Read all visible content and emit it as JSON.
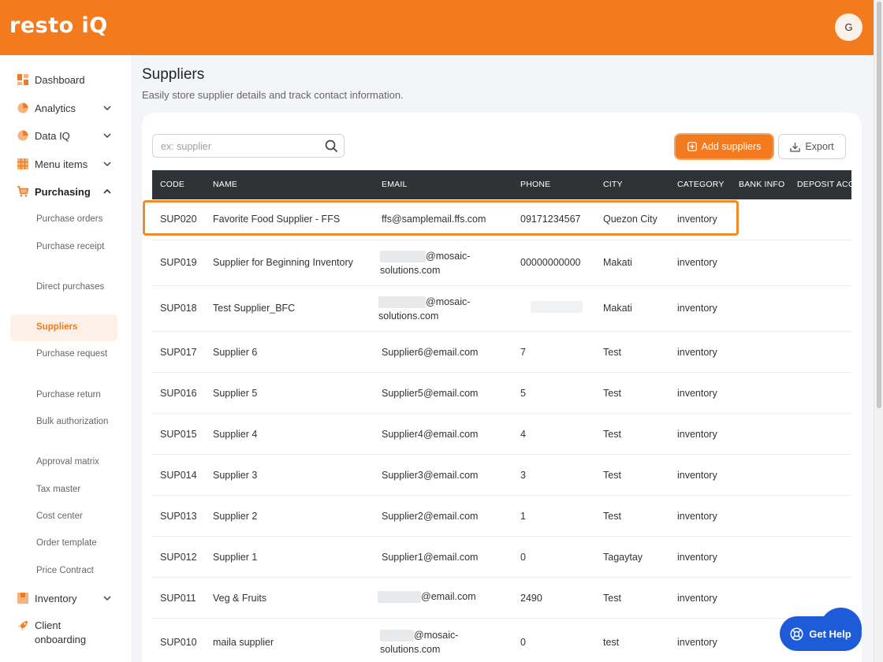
{
  "app": {
    "logo": "resto iQ",
    "user_initial": "G"
  },
  "sidebar": {
    "top": [
      {
        "label": "Dashboard",
        "icon": "dashboard-icon"
      },
      {
        "label": "Analytics",
        "icon": "analytics-icon"
      },
      {
        "label": "Data IQ",
        "icon": "data-iq-icon"
      },
      {
        "label": "Menu items",
        "icon": "menu-items-icon"
      },
      {
        "label": "Purchasing",
        "icon": "cart-icon"
      }
    ],
    "purchasing_sub": [
      "Purchase orders",
      "Purchase receipt",
      "Direct purchases",
      "Suppliers",
      "Purchase request",
      "Purchase return",
      "Bulk authorization",
      "Approval matrix",
      "Tax master",
      "Cost center",
      "Order template",
      "Price Contract"
    ],
    "bottom": [
      {
        "label": "Inventory",
        "icon": "inventory-icon"
      },
      {
        "label": "Client onboarding",
        "icon": "rocket-icon"
      }
    ]
  },
  "page": {
    "title": "Suppliers",
    "subtitle": "Easily store supplier details and track contact information."
  },
  "toolbar": {
    "search_placeholder": "ex: supplier",
    "add_label": "Add suppliers",
    "export_label": "Export"
  },
  "table": {
    "columns": [
      "CODE",
      "NAME",
      "EMAIL",
      "PHONE",
      "CITY",
      "CATEGORY",
      "BANK INFO",
      "DEPOSIT ACC"
    ],
    "rows": [
      {
        "code": "SUP020",
        "name": "Favorite Food Supplier - FFS",
        "email": "ffs@samplemail.ffs.com",
        "phone": "09171234567",
        "city": "Quezon City",
        "category": "inventory"
      },
      {
        "code": "SUP019",
        "name": "Supplier for Beginning Inventory",
        "email": "@mosaic-solutions.com",
        "phone": "00000000000",
        "city": "Makati",
        "category": "inventory"
      },
      {
        "code": "SUP018",
        "name": "Test Supplier_BFC",
        "email": "@mosaic-solutions.com",
        "phone": "",
        "city": "Makati",
        "category": "inventory"
      },
      {
        "code": "SUP017",
        "name": "Supplier 6",
        "email": "Supplier6@email.com",
        "phone": "7",
        "city": "Test",
        "category": "inventory"
      },
      {
        "code": "SUP016",
        "name": "Supplier 5",
        "email": "Supplier5@email.com",
        "phone": "5",
        "city": "Test",
        "category": "inventory"
      },
      {
        "code": "SUP015",
        "name": "Supplier 4",
        "email": "Supplier4@email.com",
        "phone": "4",
        "city": "Test",
        "category": "inventory"
      },
      {
        "code": "SUP014",
        "name": "Supplier 3",
        "email": "Supplier3@email.com",
        "phone": "3",
        "city": "Test",
        "category": "inventory"
      },
      {
        "code": "SUP013",
        "name": "Supplier 2",
        "email": "Supplier2@email.com",
        "phone": "1",
        "city": "Test",
        "category": "inventory"
      },
      {
        "code": "SUP012",
        "name": "Supplier 1",
        "email": "Supplier1@email.com",
        "phone": "0",
        "city": "Tagaytay",
        "category": "inventory"
      },
      {
        "code": "SUP011",
        "name": "Veg & Fruits",
        "email": "@email.com",
        "phone": "2490",
        "city": "Test",
        "category": "inventory"
      },
      {
        "code": "SUP010",
        "name": "maila supplier",
        "email": "@mosaic-solutions.com",
        "phone": "0",
        "city": "test",
        "category": "inventory"
      }
    ]
  },
  "help": {
    "label": "Get Help"
  },
  "colors": {
    "brand": "#f47a1e",
    "header_dark": "#303336",
    "help_blue": "#1e5bd8"
  }
}
